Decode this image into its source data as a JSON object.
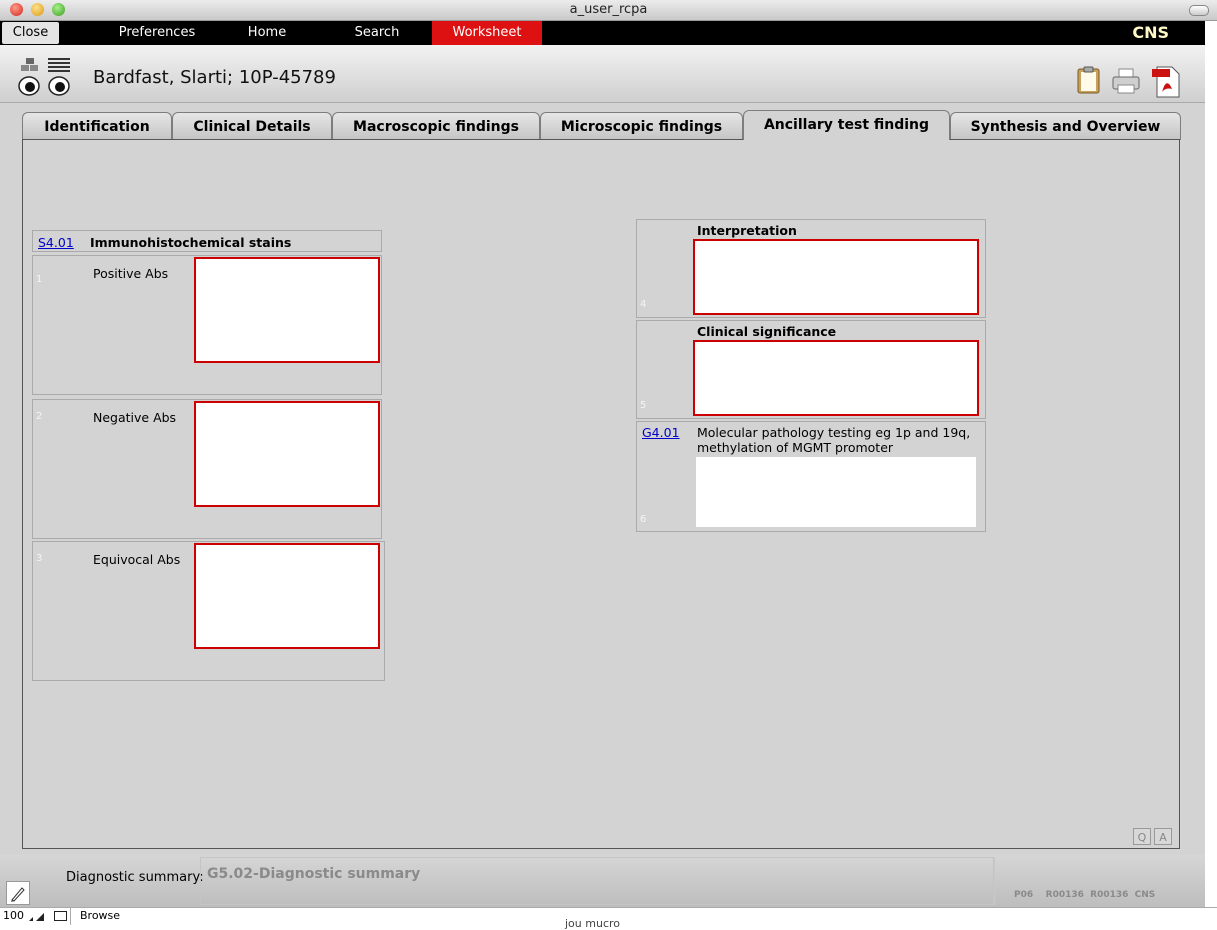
{
  "window": {
    "title": "a_user_rcpa"
  },
  "nav": {
    "close": "Close",
    "items": [
      "Preferences",
      "Home",
      "Search",
      "Worksheet"
    ],
    "active": "Worksheet",
    "module": "CNS",
    "active_color": "#dd1111"
  },
  "header": {
    "patient": "Bardfast, Slarti; 10P-45789"
  },
  "tabs": [
    "Identification",
    "Clinical Details",
    "Macroscopic findings",
    "Microscopic findings",
    "Ancillary test finding",
    "Synthesis and Overview"
  ],
  "active_tab": "Ancillary test finding",
  "left_section": {
    "code": "S4.01",
    "title": "Immunohistochemical stains",
    "fields": [
      {
        "num": "1",
        "label": "Positive Abs",
        "value": ""
      },
      {
        "num": "2",
        "label": "Negative Abs",
        "value": ""
      },
      {
        "num": "3",
        "label": "Equivocal Abs",
        "value": ""
      }
    ]
  },
  "right_section": {
    "fields": [
      {
        "num": "4",
        "label": "Interpretation",
        "value": ""
      },
      {
        "num": "5",
        "label": "Clinical significance",
        "value": ""
      },
      {
        "num": "6",
        "code": "G4.01",
        "label": "Molecular pathology testing eg 1p and 19q, methylation of MGMT promoter",
        "value": ""
      }
    ]
  },
  "qa": {
    "q": "Q",
    "a": "A"
  },
  "footer": {
    "summary_label": "Diagnostic summary:",
    "summary_value": "G5.02-Diagnostic summary",
    "status_codes": "P06    R00136  R00136  CNS"
  },
  "statusbar": {
    "zoom": "100",
    "mode": "Browse",
    "behind_text": "jou mucro"
  },
  "icons": [
    "eye-left-icon",
    "eye-right-icon",
    "clipboard-icon",
    "printer-icon",
    "pdf-icon",
    "pen-icon"
  ]
}
